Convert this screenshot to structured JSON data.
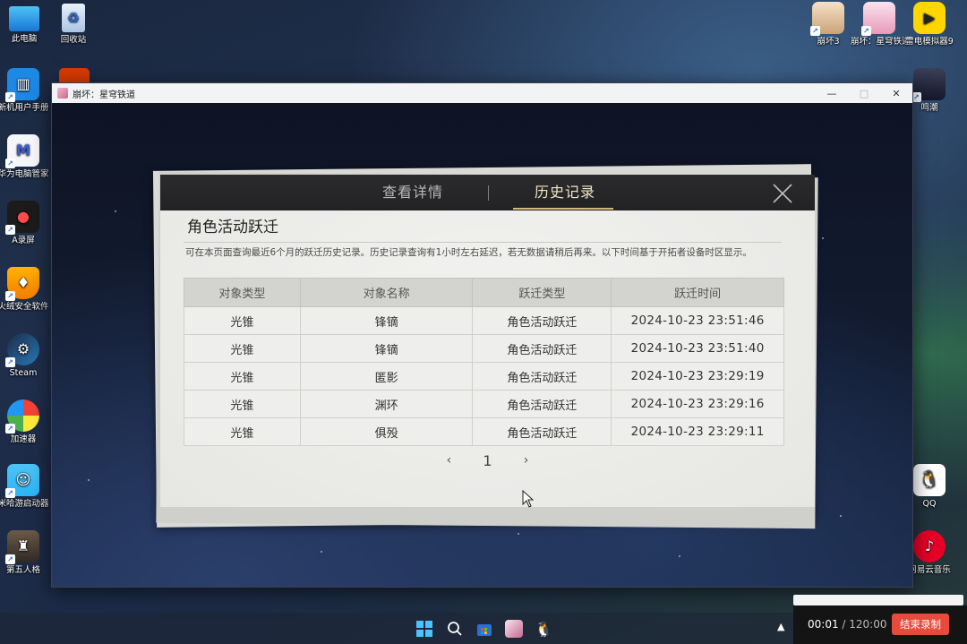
{
  "desktop": {
    "left_icons": [
      {
        "label": "此电脑",
        "icon": "computer-icon"
      },
      {
        "label": "回收站",
        "icon": "recycle-bin-icon"
      },
      {
        "label": "新机用户手册",
        "icon": "manual-icon"
      },
      {
        "label": "华为电脑管家",
        "icon": "huawei-manager-icon"
      },
      {
        "label": "A录屏",
        "icon": "screen-recorder-icon"
      },
      {
        "label": "火绒安全软件",
        "icon": "huorong-icon"
      },
      {
        "label": "Steam",
        "icon": "steam-icon"
      },
      {
        "label": "加速器",
        "icon": "accelerator-icon"
      },
      {
        "label": "米哈游启动器",
        "icon": "mihoyo-launcher-icon"
      },
      {
        "label": "第五人格",
        "icon": "identity-v-icon"
      }
    ],
    "right_icons": [
      {
        "label": "崩坏3",
        "icon": "honkai3-icon"
      },
      {
        "label": "崩坏：星穹铁道",
        "icon": "star-rail-icon"
      },
      {
        "label": "雷电模拟器9",
        "icon": "ldplayer-icon"
      },
      {
        "label": "鸣潮",
        "icon": "wuthering-waves-icon"
      },
      {
        "label": "QQ",
        "icon": "qq-icon"
      },
      {
        "label": "网易云音乐",
        "icon": "netease-music-icon"
      }
    ]
  },
  "window": {
    "title": "崩坏：星穹铁道",
    "minimize": "—",
    "maximize": "□",
    "close": "✕"
  },
  "dialog": {
    "tabs": [
      {
        "label": "查看详情",
        "active": false
      },
      {
        "label": "历史记录",
        "active": true
      }
    ],
    "title": "角色活动跃迁",
    "description": "可在本页面查询最近6个月的跃迁历史记录。历史记录查询有1小时左右延迟，若无数据请稍后再来。以下时间基于开拓者设备时区显示。",
    "columns": [
      "对象类型",
      "对象名称",
      "跃迁类型",
      "跃迁时间"
    ],
    "rows": [
      [
        "光锥",
        "锋镝",
        "角色活动跃迁",
        "2024-10-23 23:51:46"
      ],
      [
        "光锥",
        "锋镝",
        "角色活动跃迁",
        "2024-10-23 23:51:40"
      ],
      [
        "光锥",
        "匿影",
        "角色活动跃迁",
        "2024-10-23 23:29:19"
      ],
      [
        "光锥",
        "渊环",
        "角色活动跃迁",
        "2024-10-23 23:29:16"
      ],
      [
        "光锥",
        "俱殁",
        "角色活动跃迁",
        "2024-10-23 23:29:11"
      ]
    ],
    "pager": {
      "prev": "‹",
      "page": "1",
      "next": "›"
    }
  },
  "recorder": {
    "elapsed": "00:01",
    "total": "/ 120:00",
    "stop_label": "结束录制"
  },
  "taskbar": {
    "icons": [
      "windows-start-icon",
      "search-icon",
      "store-icon",
      "star-rail-taskbar-icon",
      "qq-taskbar-icon"
    ]
  }
}
